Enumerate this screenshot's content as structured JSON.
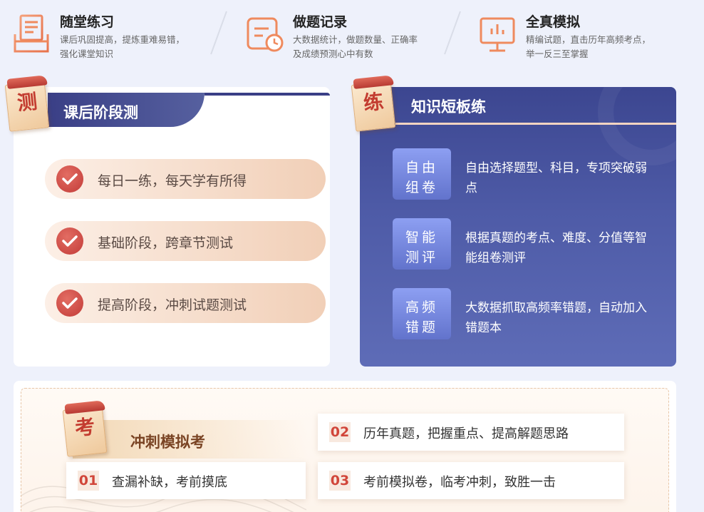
{
  "features": [
    {
      "title": "随堂练习",
      "desc": "课后巩固提高，提炼重难易错，强化课堂知识",
      "icon": "document-tray-icon"
    },
    {
      "title": "做题记录",
      "desc": "大数据统计，做题数量、正确率及成绩预测心中有数",
      "icon": "record-clock-icon"
    },
    {
      "title": "全真模拟",
      "desc": "精编试题，直击历年高频考点，举一反三至掌握",
      "icon": "monitor-chart-icon"
    }
  ],
  "left_card": {
    "badge": "测",
    "title": "课后阶段测",
    "items": [
      "每日一练，每天学有所得",
      "基础阶段，跨章节测试",
      "提高阶段，冲刺试题测试"
    ]
  },
  "right_card": {
    "badge": "练",
    "title": "知识短板练",
    "items": [
      {
        "tag1": "自由",
        "tag2": "组卷",
        "desc": "自由选择题型、科目，专项突破弱点"
      },
      {
        "tag1": "智能",
        "tag2": "测评",
        "desc": "根据真题的考点、难度、分值等智能组卷测评"
      },
      {
        "tag1": "高频",
        "tag2": "错题",
        "desc": "大数据抓取高频率错题，自动加入错题本"
      }
    ]
  },
  "bottom_card": {
    "badge": "考",
    "title": "冲刺模拟考",
    "items": [
      {
        "num": "01",
        "text": "查漏补缺，考前摸底"
      },
      {
        "num": "02",
        "text": "历年真题，把握重点、提高解题思路"
      },
      {
        "num": "03",
        "text": "考前模拟卷，临考冲刺，致胜一击"
      }
    ]
  },
  "colors": {
    "accent_orange": "#ef8a5e",
    "navy": "#3c4690",
    "red": "#c33c30"
  }
}
